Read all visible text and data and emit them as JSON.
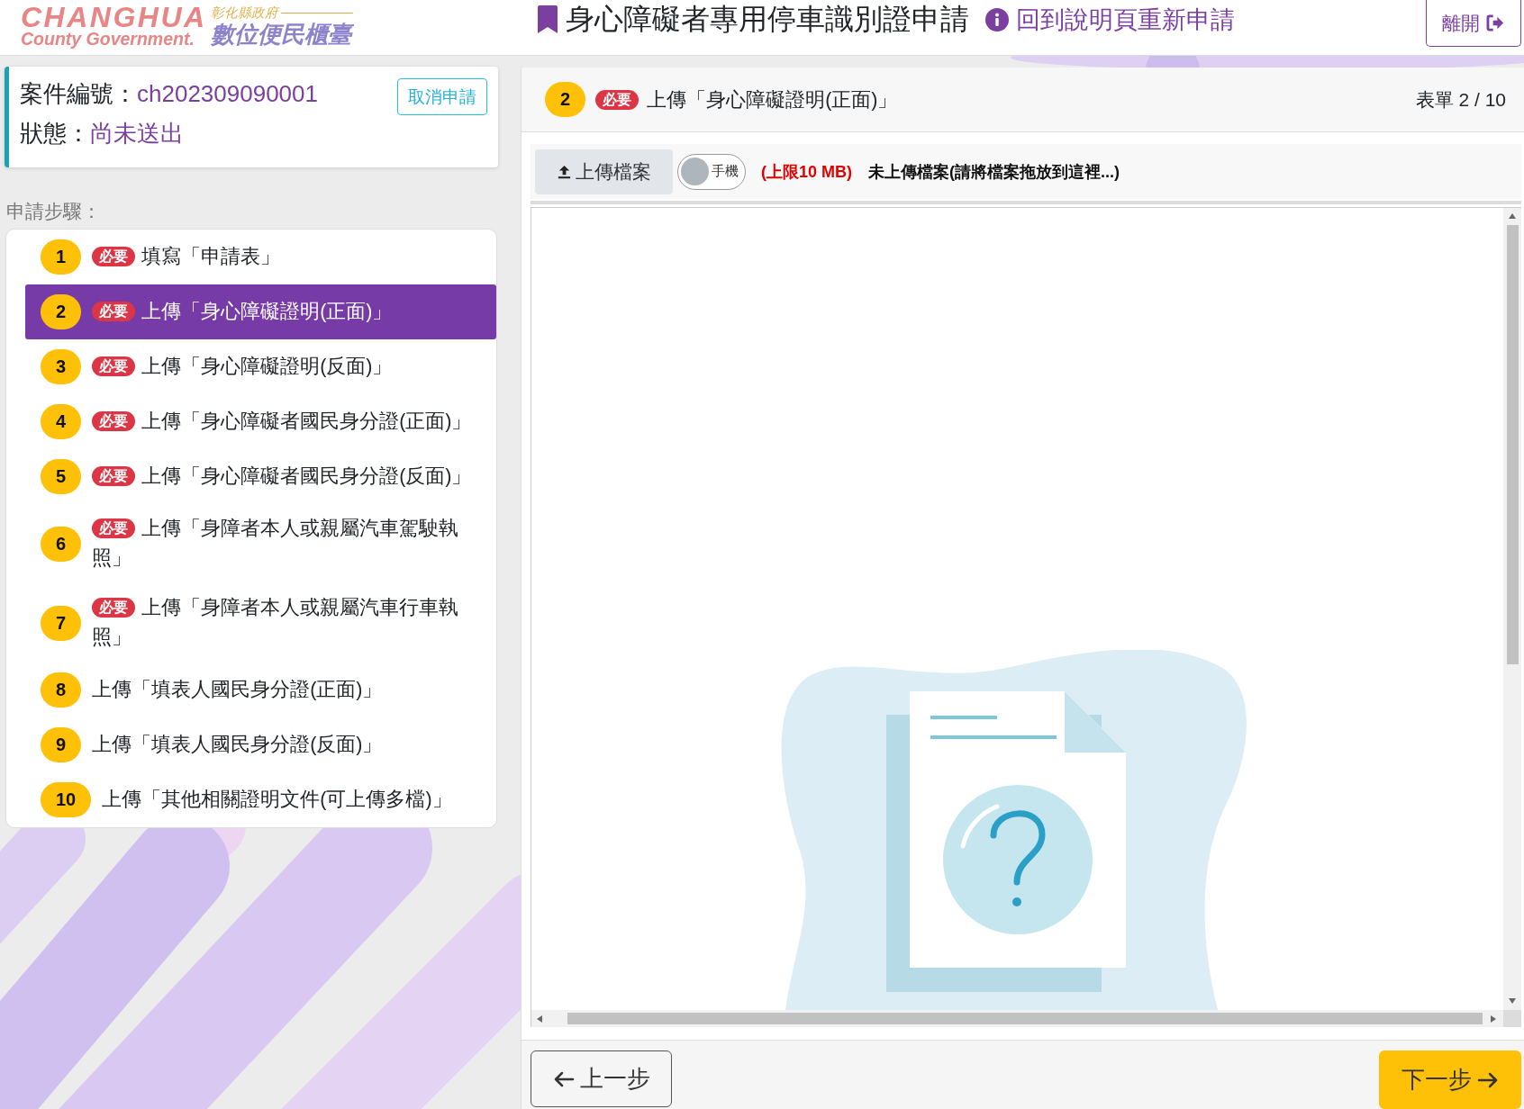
{
  "header": {
    "logo": {
      "latin_name": "CHANGHUA",
      "latin_subtitle": "County Government.",
      "agency": "彰化縣政府",
      "service": "數位便民櫃臺"
    },
    "title": "身心障礙者專用停車識別證申請",
    "help_link": "回到說明頁重新申請",
    "exit_button": "離開"
  },
  "case": {
    "number_label": "案件編號：",
    "number": "ch202309090001",
    "status_label": "狀態：",
    "status": "尚未送出",
    "cancel_button": "取消申請"
  },
  "steps_label": "申請步驟：",
  "steps": [
    {
      "number": "1",
      "badge": "必要",
      "label": "填寫「申請表」",
      "selected": false
    },
    {
      "number": "2",
      "badge": "必要",
      "label": "上傳「身心障礙證明(正面)」",
      "selected": true
    },
    {
      "number": "3",
      "badge": "必要",
      "label": "上傳「身心障礙證明(反面)」",
      "selected": false
    },
    {
      "number": "4",
      "badge": "必要",
      "label": "上傳「身心障礙者國民身分證(正面)」",
      "selected": false
    },
    {
      "number": "5",
      "badge": "必要",
      "label": "上傳「身心障礙者國民身分證(反面)」",
      "selected": false
    },
    {
      "number": "6",
      "badge": "必要",
      "label": "上傳「身障者本人或親屬汽車駕駛執照」",
      "selected": false
    },
    {
      "number": "7",
      "badge": "必要",
      "label": "上傳「身障者本人或親屬汽車行車執照」",
      "selected": false
    },
    {
      "number": "8",
      "label": "上傳「填表人國民身分證(正面)」",
      "selected": false
    },
    {
      "number": "9",
      "label": "上傳「填表人國民身分證(反面)」",
      "selected": false
    },
    {
      "number": "10",
      "label": "上傳「其他相關證明文件(可上傳多檔)」",
      "selected": false
    }
  ],
  "form": {
    "number": "2",
    "badge": "必要",
    "title": "上傳「身心障礙證明(正面)」",
    "counter": "表單 2 / 10",
    "upload_button": "上傳檔案",
    "toggle": {
      "label": "手機",
      "on": false
    },
    "size_limit": "(上限10 MB)",
    "file_status": "未上傳檔案(請將檔案拖放到這裡...)"
  },
  "navigation": {
    "previous": "上一步",
    "next": "下一步"
  }
}
